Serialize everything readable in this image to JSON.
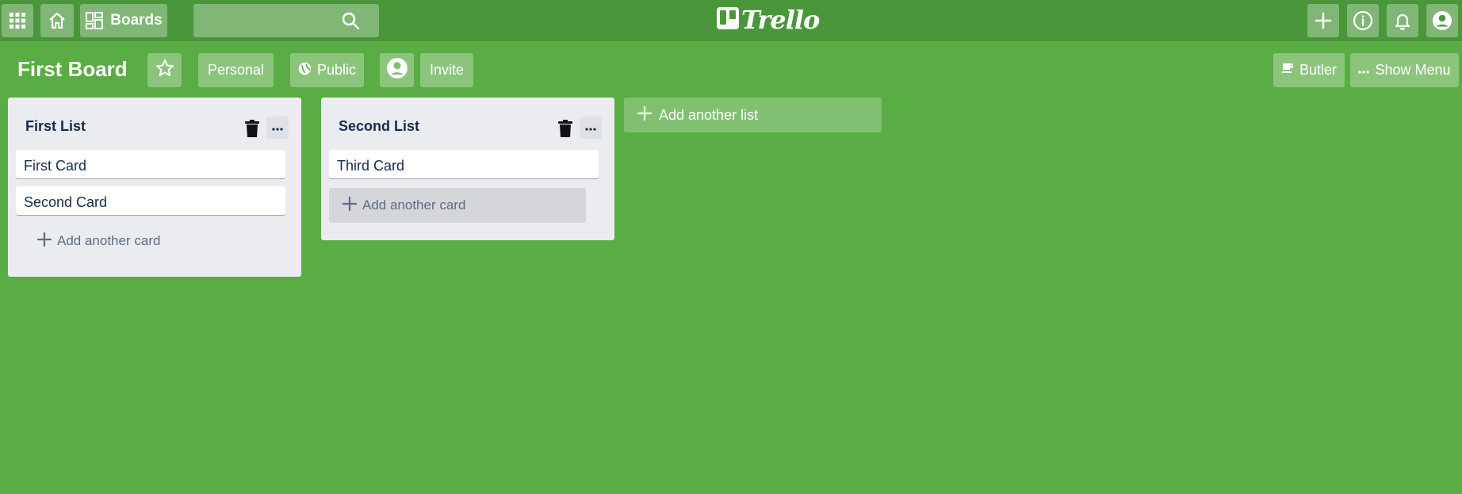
{
  "topbar": {
    "boards_label": "Boards",
    "search": {
      "value": "",
      "placeholder": ""
    },
    "logo_text": "Trello",
    "icons": [
      "apps-icon",
      "home-icon",
      "boards-icon",
      "search-icon",
      "plus-icon",
      "info-icon",
      "bell-icon",
      "account-icon"
    ]
  },
  "board": {
    "title": "First Board",
    "visibility_team": "Personal",
    "visibility": "Public",
    "invite_label": "Invite",
    "butler_label": "Butler",
    "show_menu_label": "Show Menu"
  },
  "lists": [
    {
      "title": "First List",
      "cards": [
        "First Card",
        "Second Card"
      ],
      "add_card_label": "Add another card"
    },
    {
      "title": "Second List",
      "cards": [
        "Third Card"
      ],
      "add_card_label": "Add another card"
    }
  ],
  "add_list_label": "Add another list",
  "colors": {
    "background": "#5aac44",
    "topbar": "#4a973b",
    "list_bg": "#ebecf0",
    "card_bg": "#ffffff",
    "text_dark": "#172b4d",
    "text_muted": "#5e6c84"
  }
}
